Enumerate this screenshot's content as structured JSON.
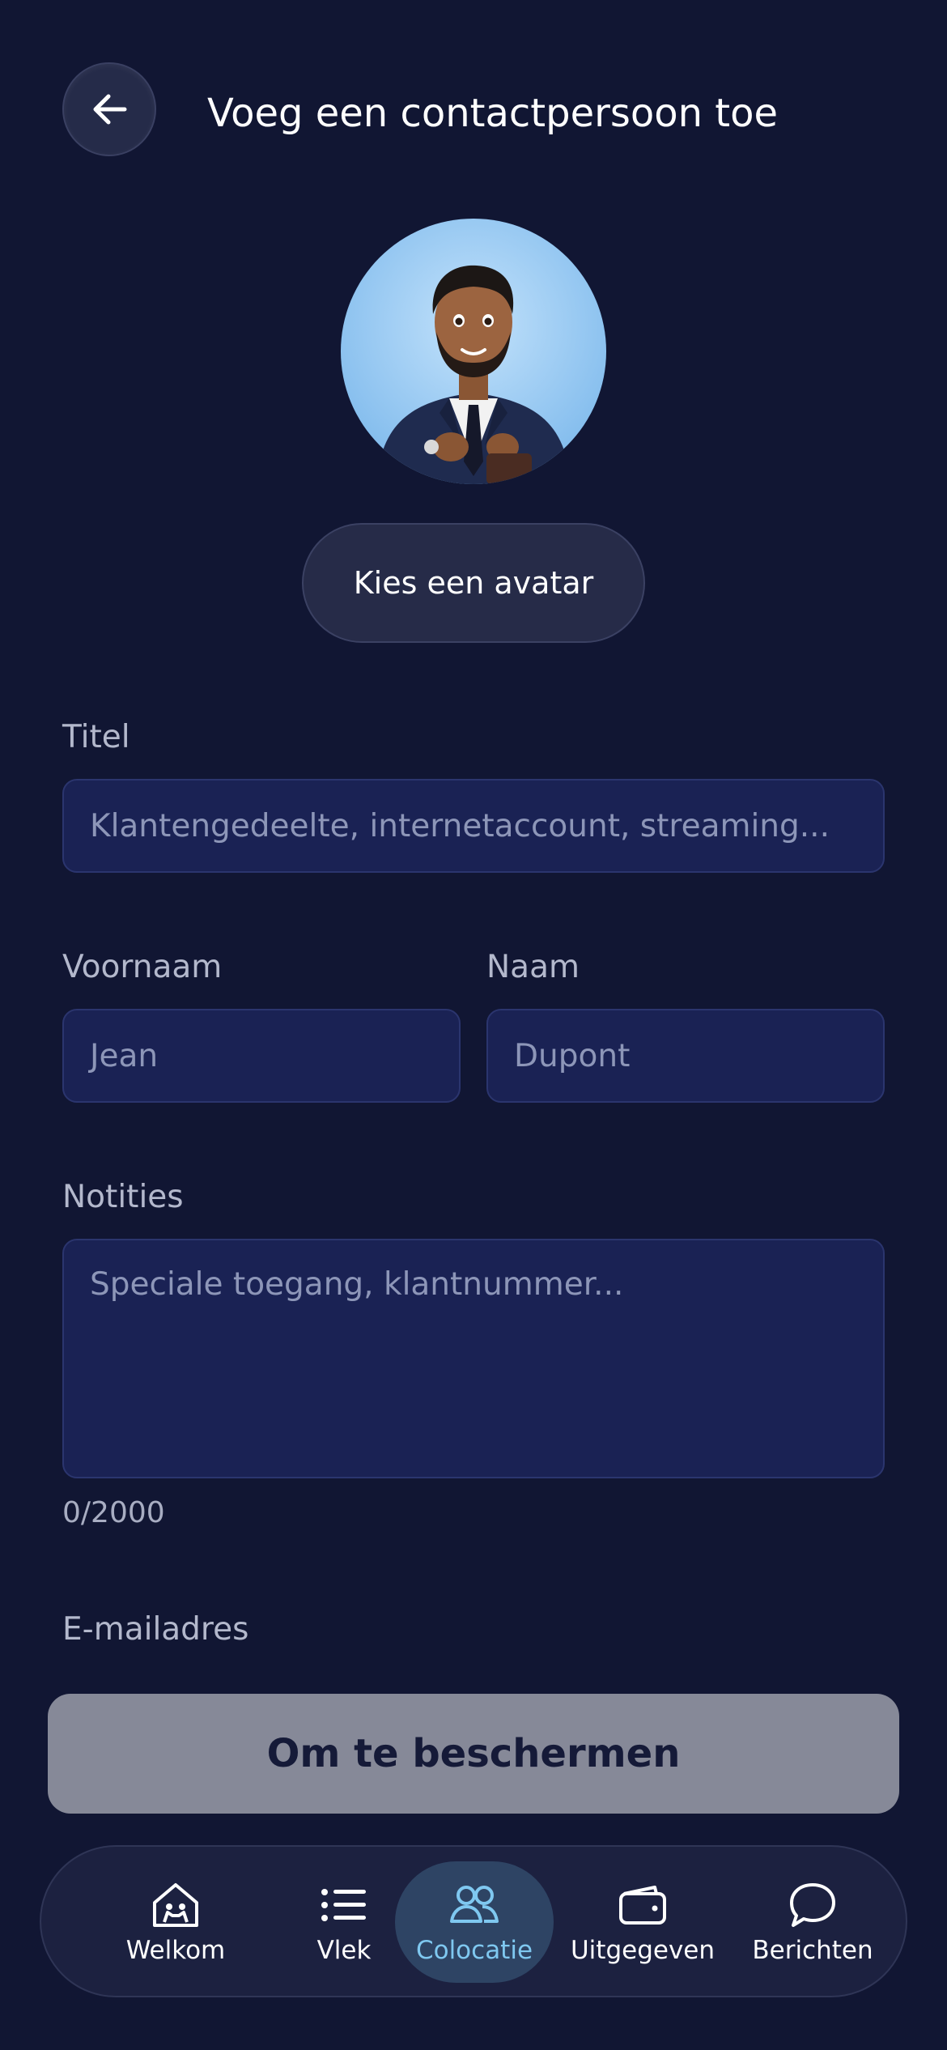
{
  "header": {
    "title": "Voeg een contactpersoon toe"
  },
  "avatar": {
    "choose_label": "Kies een avatar"
  },
  "form": {
    "title": {
      "label": "Titel",
      "placeholder": "Klantengedeelte, internetaccount, streaming..."
    },
    "first_name": {
      "label": "Voornaam",
      "placeholder": "Jean"
    },
    "last_name": {
      "label": "Naam",
      "placeholder": "Dupont"
    },
    "notes": {
      "label": "Notities",
      "placeholder": "Speciale toegang, klantnummer...",
      "counter": "0/2000"
    },
    "email": {
      "label": "E-mailadres"
    }
  },
  "save_label": "Om te beschermen",
  "tabbar": {
    "items": [
      {
        "label": "Welkom",
        "icon": "home-icon",
        "active": false
      },
      {
        "label": "Vlek",
        "icon": "list-icon",
        "active": false
      },
      {
        "label": "Colocatie",
        "icon": "people-icon",
        "active": true
      },
      {
        "label": "Uitgegeven",
        "icon": "wallet-icon",
        "active": false
      },
      {
        "label": "Berichten",
        "icon": "chat-icon",
        "active": false
      }
    ]
  },
  "colors": {
    "background": "#111633",
    "field": "#1a2254",
    "active_tab": "#7fc8f0",
    "save_button": "#868998"
  }
}
